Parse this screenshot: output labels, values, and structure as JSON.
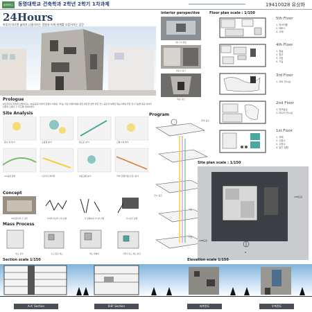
{
  "header": {
    "logo_text": "동명대학교",
    "title": "동명대학교 건축학과 2학년 2학기 1차과제",
    "student": "19410028 유상화"
  },
  "project": {
    "title": "24Hours",
    "subtitle": "하루가 지나면 삶처가 나들거리는 정원과 이뤄 관계를 다듬어가는 공간"
  },
  "sections": {
    "interior": "interior perspective",
    "floor_plan": "Floor plan scale : 1/150",
    "prologue": "Prologue",
    "site_analysis": "Site Analysis",
    "program": "Program",
    "concept": "Concept",
    "mass_process": "Mass Process",
    "site_plan": "Site plan scale : 1/150",
    "section": "Section scale 1/150",
    "elevation": "Elevation scale 1/150"
  },
  "interior_captions": [
    "3층 전시 통로",
    "펜트리 공간",
    "옥상 공간"
  ],
  "floors": [
    {
      "label": "5th Floor",
      "items": [
        "1. 마스터룸",
        "2. 테라스",
        "3. 서재"
      ]
    },
    {
      "label": "4th Floor",
      "items": [
        "1. 침실",
        "2. 창고",
        "3. 주방",
        "4. 거실"
      ]
    },
    {
      "label": "3rd Floor",
      "items": [
        "1. 아트 전시실"
      ]
    },
    {
      "label": "2nd Floor",
      "items": [
        "1. 워크숍실",
        "2. 미디어 전시실"
      ]
    },
    {
      "label": "1st Floor",
      "items": [
        "1. 카페",
        "2. 수장고",
        "3. 수장고",
        "4. 갈기 정원"
      ]
    }
  ],
  "prologue_text": "부산주민의 학습을 만들어주는 UN공원과 더불어 한편의 여유를 가지는 작은 아틀리에를 만든 대단한 삶을 위한 전시 공간과 부족한 재능기부를 위한 전시기능을 제공 하여주민들과 소통할 수 있도록 계획하였다.",
  "site_analysis": {
    "labels": [
      "동서 축 높이",
      "소음원 분석",
      "동도로 분석",
      "교통시설 분석",
      "UN공원 탐방",
      "1단거리 매력화",
      "대중교통 분석",
      "지역 연결지점(출입) 분석"
    ]
  },
  "program": {
    "labels": [
      "주택 공간",
      "전시 공간",
      "아트",
      "작업"
    ]
  },
  "concept": {
    "captions": [
      "UN공원과의 산 공원",
      "지하와 대로변 사이 흐름",
      "한 흐름속에 전시된 작품",
      "전시공간 흐름"
    ]
  },
  "mass_process": {
    "captions": [
      "매스 분할",
      "깊고 얇은 매스",
      "매스 재배치",
      "작업과 창고 매스 분할"
    ]
  },
  "site_plan": {
    "road1": "20M도로",
    "road2": "10M도로",
    "label": "N"
  },
  "section_labels": [
    "A-A' Section",
    "B-B' Section"
  ],
  "elevation_labels": [
    "좌측면도",
    "우측면도"
  ],
  "colors": {
    "header_title": "#1d3a6e",
    "accent": "#2c3e63",
    "highlight_yellow": "#f3d13a",
    "highlight_teal": "#48a7a0",
    "site_dark": "#3c3f45"
  }
}
